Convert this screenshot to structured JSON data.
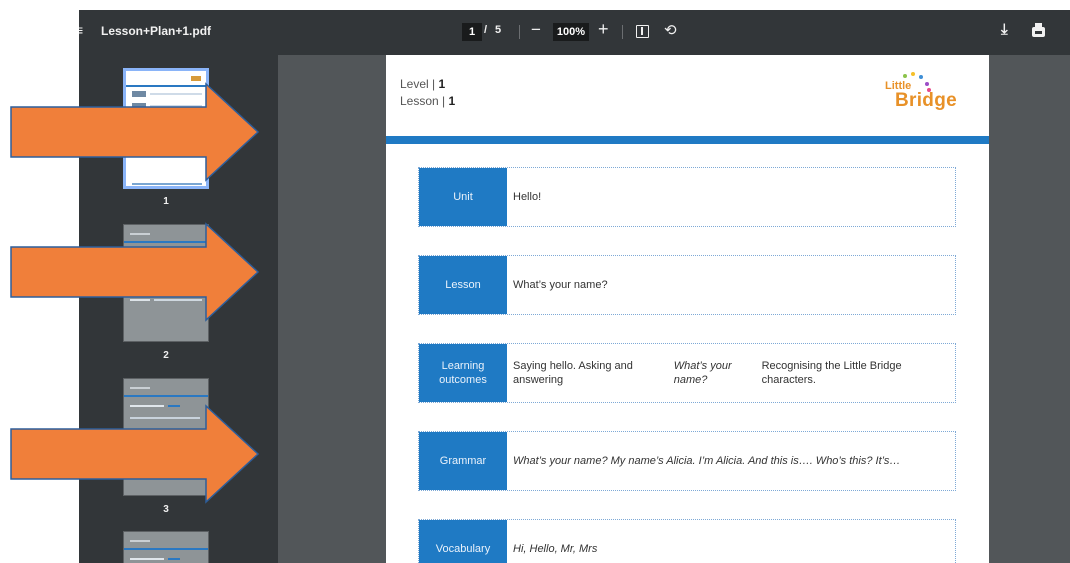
{
  "toolbar": {
    "menu_glyph": "≡",
    "file_name": "Lesson+Plan+1.pdf",
    "current_page": "1",
    "page_separator": "/",
    "total_pages": "5",
    "zoom_out": "−",
    "zoom": "100%",
    "zoom_in": "+",
    "icons": [
      "menu-icon",
      "fit-page-icon",
      "rotate-icon",
      "download-icon",
      "print-icon",
      "more-icon"
    ]
  },
  "sidebar": {
    "thumbnails": [
      {
        "page": "1",
        "active": true
      },
      {
        "page": "2",
        "active": false
      },
      {
        "page": "3",
        "active": false
      },
      {
        "page": "4",
        "active": false
      }
    ]
  },
  "document": {
    "level_label": "Level |",
    "level_value": "1",
    "lesson_label": "Lesson |",
    "lesson_value": "1",
    "logo_top": "Little",
    "logo_bottom": "Bridge",
    "rows": [
      {
        "label": "Unit",
        "value": "Hello!"
      },
      {
        "label": "Lesson",
        "value": "What’s your name?"
      },
      {
        "label": "Learning outcomes",
        "value_pre": "Saying hello. Asking and answering ",
        "value_italic": "What’s your name?",
        "value_post": " Recognising the Little Bridge characters."
      },
      {
        "label": "Grammar",
        "value": "What’s your name? My name’s Alicia. I’m Alicia. And this is….   Who’s this?  It’s…"
      },
      {
        "label": "Vocabulary",
        "value": "Hi, Hello, Mr, Mrs"
      }
    ]
  },
  "colors": {
    "toolbar_bg": "#323639",
    "viewer_bg": "#525659",
    "accent_blue": "#1f7ac4",
    "logo_orange": "#e89128",
    "arrow_orange": "#f07f3a",
    "arrow_border": "#2d5e9b"
  }
}
